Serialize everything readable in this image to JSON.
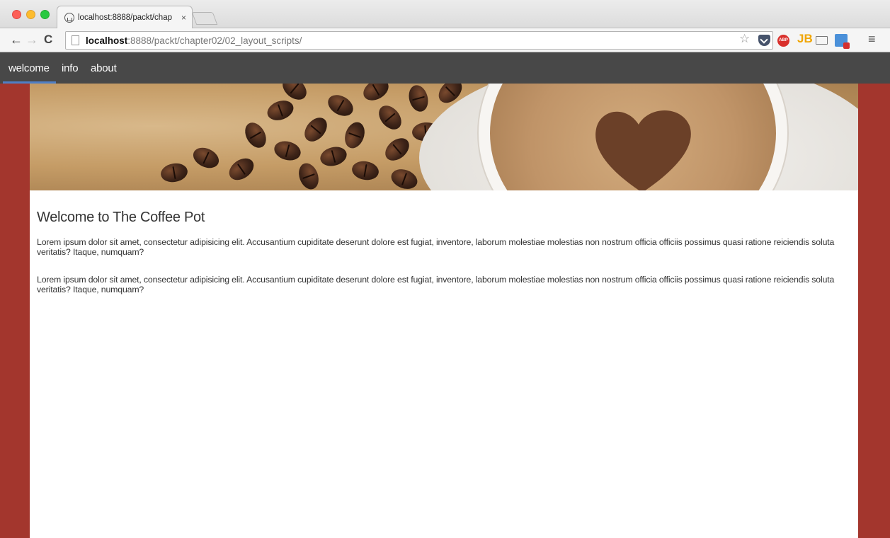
{
  "browser": {
    "tab_title": "localhost:8888/packt/chap",
    "tab_close": "×",
    "url_host": "localhost",
    "url_rest": ":8888/packt/chapter02/02_layout_scripts/",
    "extensions": {
      "abp_label": "ABP",
      "jb_label": "JB"
    }
  },
  "app": {
    "nav": {
      "items": [
        {
          "label": "welcome",
          "active": true
        },
        {
          "label": "info",
          "active": false
        },
        {
          "label": "about",
          "active": false
        }
      ]
    },
    "title": "Welcome to The Coffee Pot",
    "paragraphs": [
      "Lorem ipsum dolor sit amet, consectetur adipisicing elit. Accusantium cupiditate deserunt dolore est fugiat, inventore, laborum molestiae molestias non nostrum officia officiis possimus quasi ratione reiciendis soluta veritatis? Itaque, numquam?",
      "Lorem ipsum dolor sit amet, consectetur adipisicing elit. Accusantium cupiditate deserunt dolore est fugiat, inventore, laborum molestiae molestias non nostrum officia officiis possimus quasi ratione reiciendis soluta veritatis? Itaque, numquam?"
    ]
  },
  "colors": {
    "page_background": "#a3362d",
    "nav_background": "#484848",
    "active_underline": "#4f7fc5"
  },
  "icons": [
    "back-icon",
    "forward-icon",
    "reload-icon",
    "page-icon",
    "star-icon",
    "pocket-icon",
    "abp-icon",
    "jb-icon",
    "cast-icon",
    "app-icon",
    "menu-icon"
  ]
}
